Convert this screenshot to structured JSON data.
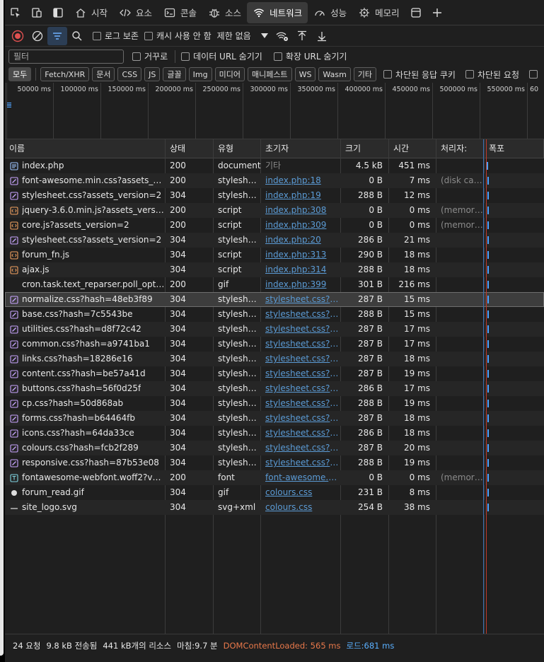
{
  "toolbar": {
    "tabs": [
      {
        "label": "시작",
        "icon": "home-icon",
        "active": false
      },
      {
        "label": "요소",
        "icon": "code-icon",
        "active": false
      },
      {
        "label": "콘솔",
        "icon": "console-icon",
        "active": false
      },
      {
        "label": "소스",
        "icon": "bug-icon",
        "active": false
      },
      {
        "label": "네트워크",
        "icon": "wifi-icon",
        "active": true
      },
      {
        "label": "성능",
        "icon": "gauge-icon",
        "active": false
      },
      {
        "label": "메모리",
        "icon": "memory-icon",
        "active": false
      }
    ]
  },
  "controls": {
    "preserve_log": "로그 보존",
    "disable_cache": "캐시 사용 안 함",
    "throttle": "제한 없음"
  },
  "filters": {
    "placeholder": "필터",
    "invert": "거꾸로",
    "hide_data_urls": "데이터 URL 숨기기",
    "hide_ext_urls": "확장 URL 숨기기",
    "types": [
      "모두",
      "Fetch/XHR",
      "문서",
      "CSS",
      "JS",
      "글꼴",
      "Img",
      "미디어",
      "매니페스트",
      "WS",
      "Wasm",
      "기타"
    ],
    "blocked_cookies": "차단된 응답 쿠키",
    "blocked_requests": "차단된 요청"
  },
  "overview": {
    "ticks": [
      "50000 ms",
      "100000 ms",
      "150000 ms",
      "200000 ms",
      "250000 ms",
      "300000 ms",
      "350000 ms",
      "400000 ms",
      "450000 ms",
      "500000 ms",
      "550000 ms",
      "60"
    ]
  },
  "table": {
    "headers": [
      "이름",
      "상태",
      "유형",
      "초기자",
      "크기",
      "시간",
      "처리자:",
      "폭포"
    ],
    "rows": [
      {
        "name": "index.php",
        "icon": "document-icon",
        "status": "200",
        "type": "document",
        "initiator": "기타",
        "init_link": false,
        "size": "4.5 kB",
        "time": "451 ms",
        "handler": ""
      },
      {
        "name": "font-awesome.min.css?assets_versi...",
        "icon": "stylesheet-icon",
        "status": "200",
        "type": "stylesheet",
        "initiator": "index.php:18",
        "init_link": true,
        "size": "0 B",
        "time": "7 ms",
        "handler": "(disk cac..."
      },
      {
        "name": "stylesheet.css?assets_version=2",
        "icon": "stylesheet-icon",
        "status": "304",
        "type": "stylesheet",
        "initiator": "index.php:19",
        "init_link": true,
        "size": "288 B",
        "time": "12 ms",
        "handler": ""
      },
      {
        "name": "jquery-3.6.0.min.js?assets_version=2",
        "icon": "script-icon",
        "status": "200",
        "type": "script",
        "initiator": "index.php:308",
        "init_link": true,
        "size": "0 B",
        "time": "0 ms",
        "handler": "(memory..."
      },
      {
        "name": "core.js?assets_version=2",
        "icon": "script-icon",
        "status": "200",
        "type": "script",
        "initiator": "index.php:309",
        "init_link": true,
        "size": "0 B",
        "time": "0 ms",
        "handler": "(memory..."
      },
      {
        "name": "stylesheet.css?assets_version=2",
        "icon": "stylesheet-icon",
        "status": "304",
        "type": "stylesheet",
        "initiator": "index.php:20",
        "init_link": true,
        "size": "286 B",
        "time": "21 ms",
        "handler": ""
      },
      {
        "name": "forum_fn.js",
        "icon": "script-icon",
        "status": "304",
        "type": "script",
        "initiator": "index.php:313",
        "init_link": true,
        "size": "290 B",
        "time": "18 ms",
        "handler": ""
      },
      {
        "name": "ajax.js",
        "icon": "script-icon",
        "status": "304",
        "type": "script",
        "initiator": "index.php:314",
        "init_link": true,
        "size": "288 B",
        "time": "18 ms",
        "handler": ""
      },
      {
        "name": "cron.task.text_reparser.poll_option",
        "icon": "none",
        "status": "200",
        "type": "gif",
        "initiator": "index.php:399",
        "init_link": true,
        "size": "301 B",
        "time": "216 ms",
        "handler": ""
      },
      {
        "name": "normalize.css?hash=48eb3f89",
        "icon": "stylesheet-icon",
        "status": "304",
        "type": "stylesheet",
        "initiator": "stylesheet.css?as...",
        "init_link": true,
        "size": "287 B",
        "time": "15 ms",
        "handler": "",
        "selected": true
      },
      {
        "name": "base.css?hash=7c5543be",
        "icon": "stylesheet-icon",
        "status": "304",
        "type": "stylesheet",
        "initiator": "stylesheet.css?as...",
        "init_link": true,
        "size": "288 B",
        "time": "15 ms",
        "handler": ""
      },
      {
        "name": "utilities.css?hash=d8f72c42",
        "icon": "stylesheet-icon",
        "status": "304",
        "type": "stylesheet",
        "initiator": "stylesheet.css?as...",
        "init_link": true,
        "size": "287 B",
        "time": "17 ms",
        "handler": ""
      },
      {
        "name": "common.css?hash=a9741ba1",
        "icon": "stylesheet-icon",
        "status": "304",
        "type": "stylesheet",
        "initiator": "stylesheet.css?as...",
        "init_link": true,
        "size": "287 B",
        "time": "17 ms",
        "handler": ""
      },
      {
        "name": "links.css?hash=18286e16",
        "icon": "stylesheet-icon",
        "status": "304",
        "type": "stylesheet",
        "initiator": "stylesheet.css?as...",
        "init_link": true,
        "size": "287 B",
        "time": "18 ms",
        "handler": ""
      },
      {
        "name": "content.css?hash=be57a41d",
        "icon": "stylesheet-icon",
        "status": "304",
        "type": "stylesheet",
        "initiator": "stylesheet.css?as...",
        "init_link": true,
        "size": "287 B",
        "time": "19 ms",
        "handler": ""
      },
      {
        "name": "buttons.css?hash=56f0d25f",
        "icon": "stylesheet-icon",
        "status": "304",
        "type": "stylesheet",
        "initiator": "stylesheet.css?as...",
        "init_link": true,
        "size": "286 B",
        "time": "17 ms",
        "handler": ""
      },
      {
        "name": "cp.css?hash=50d868ab",
        "icon": "stylesheet-icon",
        "status": "304",
        "type": "stylesheet",
        "initiator": "stylesheet.css?as...",
        "init_link": true,
        "size": "288 B",
        "time": "19 ms",
        "handler": ""
      },
      {
        "name": "forms.css?hash=b64464fb",
        "icon": "stylesheet-icon",
        "status": "304",
        "type": "stylesheet",
        "initiator": "stylesheet.css?as...",
        "init_link": true,
        "size": "287 B",
        "time": "18 ms",
        "handler": ""
      },
      {
        "name": "icons.css?hash=64da33ce",
        "icon": "stylesheet-icon",
        "status": "304",
        "type": "stylesheet",
        "initiator": "stylesheet.css?as...",
        "init_link": true,
        "size": "286 B",
        "time": "18 ms",
        "handler": ""
      },
      {
        "name": "colours.css?hash=fcb2f289",
        "icon": "stylesheet-icon",
        "status": "304",
        "type": "stylesheet",
        "initiator": "stylesheet.css?as...",
        "init_link": true,
        "size": "287 B",
        "time": "20 ms",
        "handler": ""
      },
      {
        "name": "responsive.css?hash=87b53e08",
        "icon": "stylesheet-icon",
        "status": "304",
        "type": "stylesheet",
        "initiator": "stylesheet.css?as...",
        "init_link": true,
        "size": "288 B",
        "time": "19 ms",
        "handler": ""
      },
      {
        "name": "fontawesome-webfont.woff2?v=4....",
        "icon": "font-icon",
        "status": "200",
        "type": "font",
        "initiator": "font-awesome.mi...",
        "init_link": true,
        "size": "0 B",
        "time": "0 ms",
        "handler": "(memory..."
      },
      {
        "name": "forum_read.gif",
        "icon": "image-dot-icon",
        "status": "304",
        "type": "gif",
        "initiator": "colours.css",
        "init_link": true,
        "size": "231 B",
        "time": "8 ms",
        "handler": ""
      },
      {
        "name": "site_logo.svg",
        "icon": "svg-icon",
        "status": "304",
        "type": "svg+xml",
        "initiator": "colours.css",
        "init_link": true,
        "size": "254 B",
        "time": "38 ms",
        "handler": ""
      }
    ]
  },
  "statusbar": {
    "requests": "24 요청",
    "transferred": "9.8 kB 전송됨",
    "resources": "441 kB개의 리소스",
    "finish": "마침:9.7 분",
    "dcl": "DOMContentLoaded: 565 ms",
    "load": "로드:681 ms"
  },
  "colors": {
    "accent_blue": "#4fa3ff",
    "link": "#5b9bd5",
    "dcl": "#e8784a",
    "load_line": "#c0392b",
    "record": "#e05050"
  }
}
